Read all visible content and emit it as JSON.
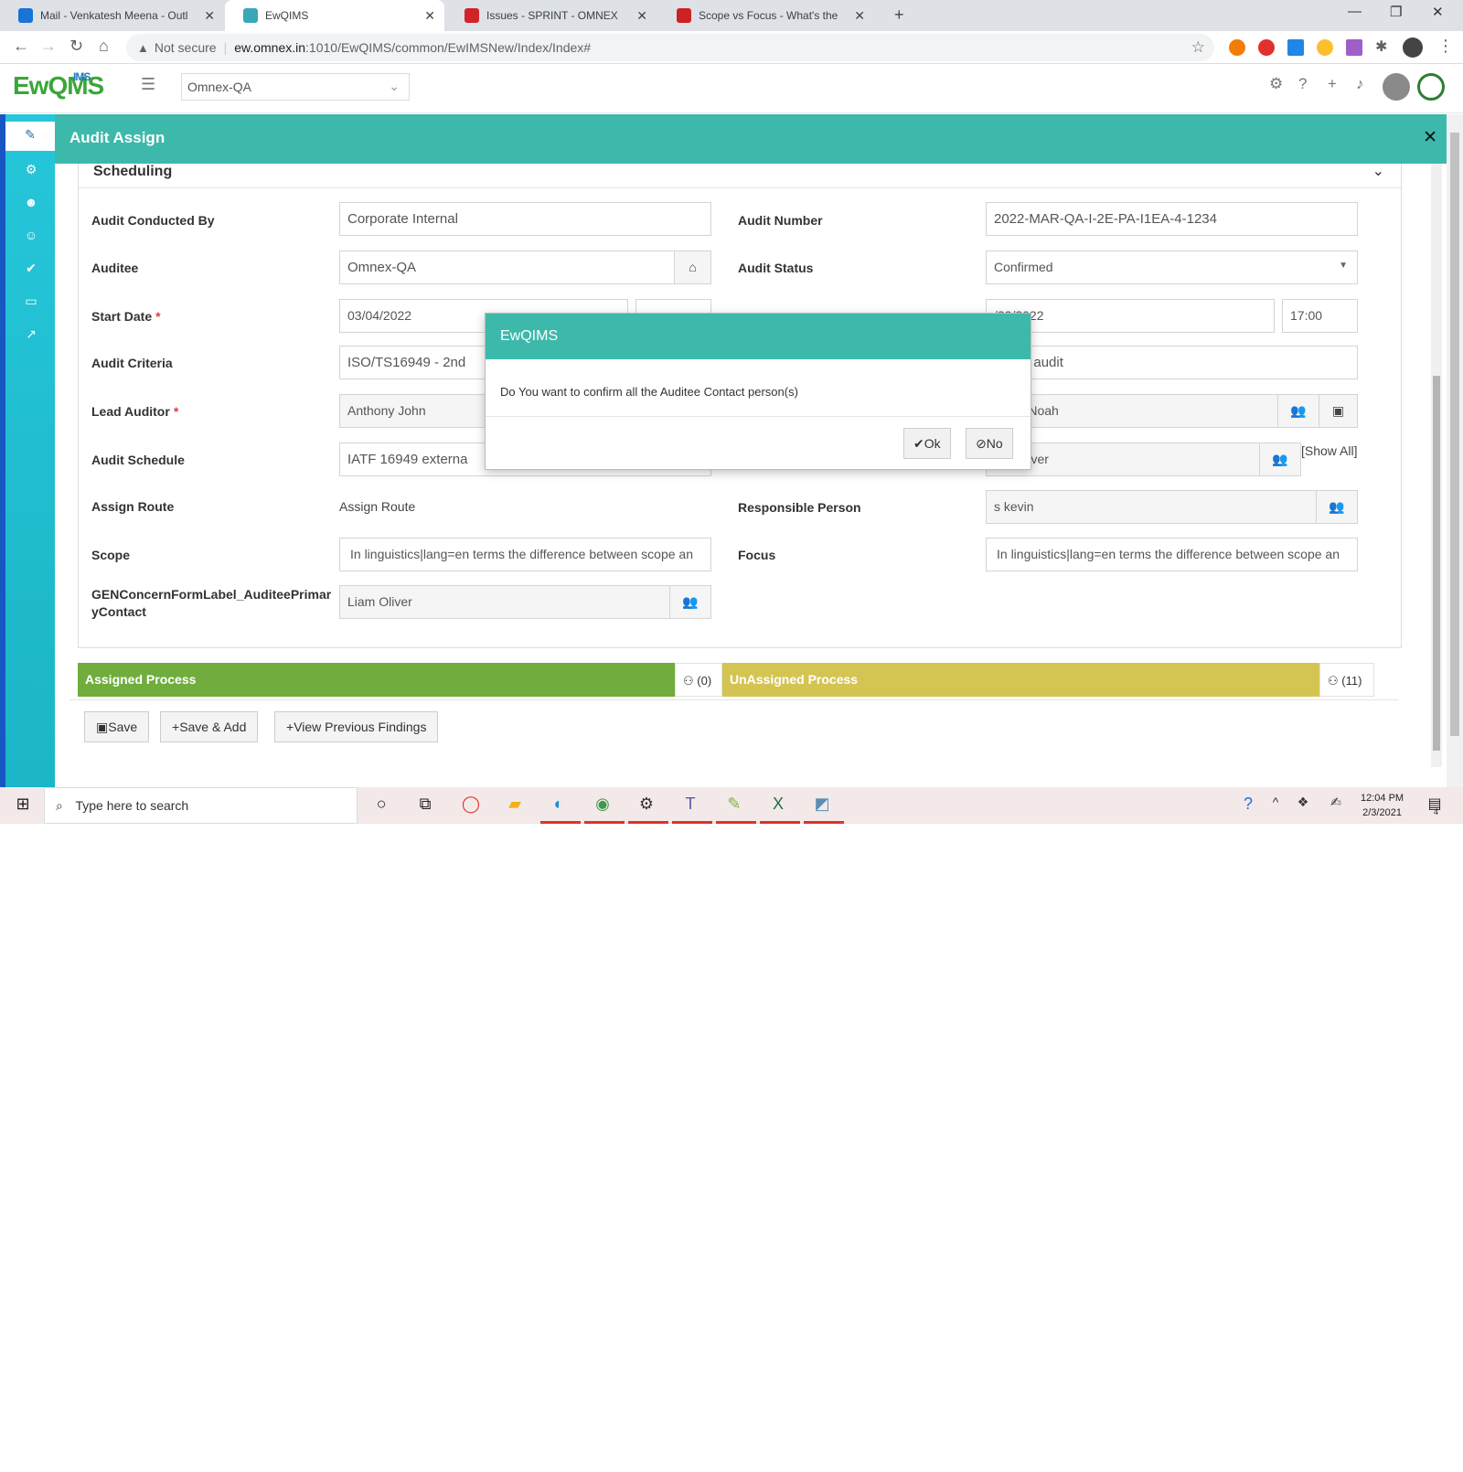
{
  "browser": {
    "tabs": [
      {
        "title": "Mail - Venkatesh Meena - Outlo",
        "icon": "outlook-icon",
        "color": "#1a73d6"
      },
      {
        "title": "EwQIMS",
        "icon": "ewqims-icon",
        "color": "#3aa6b9"
      },
      {
        "title": "Issues - SPRINT - OMNEX ISSUE T",
        "icon": "jira-icon",
        "color": "#d2232a"
      },
      {
        "title": "Scope vs Focus - What's the diffe",
        "icon": "wikidiff-icon",
        "color": "#cc2222"
      }
    ],
    "new_tab": "+",
    "security": "Not secure",
    "url_host": "ew.omnex.in",
    "url_path": ":1010/EwQIMS/common/EwIMSNew/Index/Index#"
  },
  "app": {
    "logo": "EwQMS",
    "logo_sup": "IMS",
    "org_selected": "Omnex-QA"
  },
  "modal": {
    "title": "Audit Assign",
    "section": "Scheduling",
    "fields": {
      "audit_conducted_by": {
        "label": "Audit Conducted By",
        "value": "Corporate Internal"
      },
      "audit_number": {
        "label": "Audit Number",
        "value": "2022-MAR-QA-I-2E-PA-I1EA-4-1234"
      },
      "auditee": {
        "label": "Auditee",
        "value": "Omnex-QA"
      },
      "audit_status": {
        "label": "Audit Status",
        "value": "Confirmed"
      },
      "start_date": {
        "label": "Start Date",
        "value": "03/04/2022"
      },
      "end_date": {
        "value": "/22/2022",
        "time": "17:00"
      },
      "audit_criteria": {
        "label": "Audit Criteria",
        "value": "ISO/TS16949 - 2nd"
      },
      "audit_type": {
        "value": "ocess audit"
      },
      "lead_auditor": {
        "label": "Lead Auditor",
        "value": "Anthony John"
      },
      "auditee_contact": {
        "value": "iditee Noah"
      },
      "audit_schedule": {
        "label": "Audit Schedule",
        "value": "IATF 16949 externa"
      },
      "approver": {
        "value": "am Oliver",
        "show_all": "[Show All]"
      },
      "assign_route": {
        "label": "Assign Route",
        "value": "Assign Route"
      },
      "responsible_person": {
        "label": "Responsible Person",
        "value": "s kevin"
      },
      "scope": {
        "label": "Scope",
        "value": "In linguistics|lang=en terms the difference between scope an"
      },
      "focus": {
        "label": "Focus",
        "value": "In linguistics|lang=en terms the difference between scope an"
      },
      "primary_contact": {
        "label": "GENConcernFormLabel_AuditeePrimar yContact",
        "value": "Liam Oliver"
      }
    },
    "assigned": {
      "label": "Assigned Process",
      "count": "(0)",
      "color": "#70ad3c"
    },
    "unassigned": {
      "label": "UnAssigned Process",
      "count": "(11)",
      "color": "#d4c553"
    },
    "buttons": {
      "save": "Save",
      "save_add": "Save & Add",
      "view_findings": "View Previous Findings"
    }
  },
  "dialog": {
    "title": "EwQIMS",
    "message": "Do You want to confirm all the Auditee Contact person(s)",
    "ok": "Ok",
    "no": "No"
  },
  "taskbar": {
    "search_placeholder": "Type here to search",
    "time": "12:04 PM",
    "date": "2/3/2021",
    "notifications": "4"
  }
}
